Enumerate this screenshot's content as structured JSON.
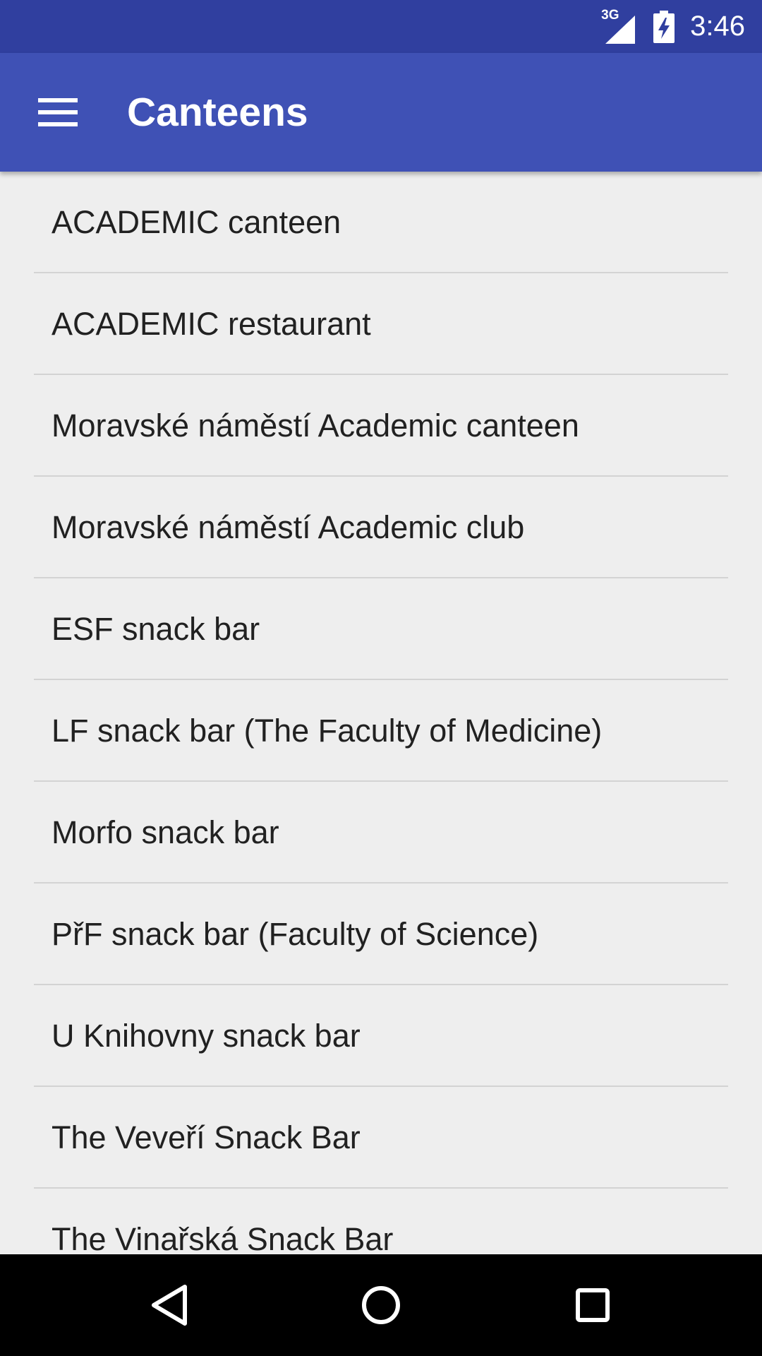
{
  "status_bar": {
    "network_type": "3G",
    "time": "3:46"
  },
  "app_bar": {
    "title": "Canteens",
    "menu_icon": "hamburger-menu-icon"
  },
  "canteens": [
    {
      "label": "ACADEMIC canteen"
    },
    {
      "label": "ACADEMIC restaurant"
    },
    {
      "label": "Moravské náměstí Academic canteen"
    },
    {
      "label": "Moravské náměstí Academic club"
    },
    {
      "label": "ESF snack bar"
    },
    {
      "label": "LF snack bar (The Faculty of Medicine)"
    },
    {
      "label": "Morfo snack bar"
    },
    {
      "label": "PřF snack bar (Faculty of Science)"
    },
    {
      "label": "U Knihovny snack bar"
    },
    {
      "label": "The Veveří Snack Bar"
    },
    {
      "label": "The Vinařská Snack Bar"
    }
  ],
  "nav_bar": {
    "back_icon": "back-triangle-icon",
    "home_icon": "home-circle-icon",
    "recents_icon": "recents-square-icon"
  },
  "colors": {
    "status_bar": "#303F9F",
    "app_bar": "#3F51B5",
    "background": "#EEEEEE",
    "divider": "#D3D3D3",
    "text": "#212121"
  }
}
